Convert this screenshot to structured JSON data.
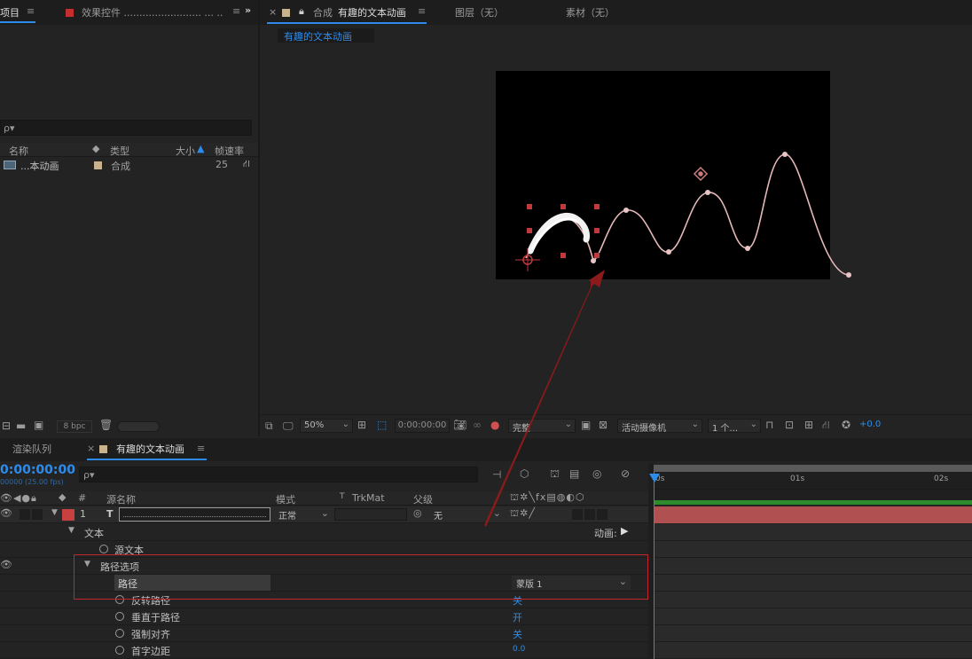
{
  "project_panel": {
    "tab_project": "项目",
    "tab_effects": "效果控件 ......................... ... ............",
    "search_placeholder": "ρ▾",
    "columns": {
      "name": "名称",
      "type": "类型",
      "size": "大小",
      "fps": "帧速率"
    },
    "items": [
      {
        "name": "...本动画",
        "type": "合成",
        "fps": "25"
      }
    ],
    "bpc": "8 bpc"
  },
  "comp_panel": {
    "tab_comp_prefix": "合成",
    "tab_comp_name": "有趣的文本动画",
    "tab_layer": "图层（无）",
    "tab_footage": "素材（无）",
    "breadcrumb": "有趣的文本动画",
    "toolbar": {
      "zoom": "50%",
      "timecode": "0:00:00:00",
      "resolution": "完整",
      "camera": "活动摄像机",
      "views": "1 个...",
      "exposure": "+0.0"
    }
  },
  "timeline": {
    "tab_render": "渲染队列",
    "tab_comp": "有趣的文本动画",
    "timecode": "0:00:00:00",
    "timecode_frames": "00000 (25.00 fps)",
    "search_placeholder": "ρ▾",
    "columns": {
      "num": "#",
      "source": "源名称",
      "mode": "模式",
      "t": "T",
      "trkmat": "TrkMat",
      "parent": "父级"
    },
    "layer": {
      "num": "1",
      "type": "T",
      "mode": "正常",
      "parent": "无"
    },
    "props": {
      "text": "文本",
      "animate": "动画:",
      "source_text": "源文本",
      "path_options": "路径选项",
      "path": "路径",
      "path_value": "蒙版 1",
      "reverse": "反转路径",
      "reverse_val": "关",
      "perpendicular": "垂直于路径",
      "perpendicular_val": "开",
      "force_align": "强制对齐",
      "force_align_val": "关",
      "first_margin": "首字边距",
      "first_margin_val": "0.0"
    },
    "ruler": [
      "0s",
      "01s",
      "02s"
    ]
  },
  "colors": {
    "accent": "#2d8ceb",
    "layer_label": "#c94040",
    "highlight_box": "#c0262c",
    "arrow": "#8b1a1a",
    "track_bar": "#b05050"
  }
}
